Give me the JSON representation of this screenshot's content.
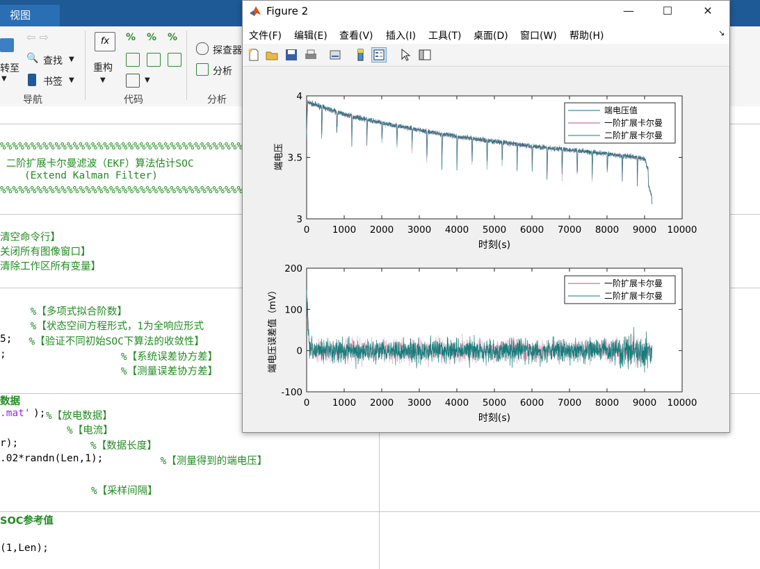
{
  "editor": {
    "tab_label": "视图",
    "ribbon": {
      "goto_label": "转至",
      "find_label": "查找",
      "bookmark_label": "书签",
      "refactor_label": "重构",
      "profiler_label": "探查器",
      "analyze_label": "分析",
      "group_nav": "导航",
      "group_code": "代码",
      "group_analyze": "分析"
    },
    "code_lines": {
      "pct1": "%%%%%%%%%%%%%%%%%%%%%%%%%%%%%%%%%%%%%%%%%%%%%%%",
      "title1": " 二阶扩展卡尔曼滤波（EKF）算法估计SOC",
      "title2": "    (Extend Kalman Filter)",
      "pct2": "%%%%%%%%%%%%%%%%%%%%%%%%%%%%%%%%%%%%%%%%%%%%%%%",
      "c1": "清空命令行】",
      "c2": "关闭所有图像窗口】",
      "c3": "清除工作区所有变量】",
      "c4": "     %【多项式拟合阶数】",
      "c5": "     %【状态空间方程形式，1为全响应形式",
      "c6_code": "5;",
      "c6": "  %【验证不同初始SOC下算法的收敛性】",
      "c7_code": ";",
      "c7": "                   %【系统误差协方差】",
      "c8": "                   %【测量误差协方差】",
      "c9": "数据",
      "c10_str": ".mat'",
      "c10_code": "); ",
      "c10": "%【放电数据】",
      "c11": "           %【电流】",
      "c12_code": "r);",
      "c12": "           %【数据长度】",
      "c13_code": ".02*randn(Len,1);",
      "c13": "         %【测量得到的端电压】",
      "c14": "               %【采样间隔】",
      "c15": "SOC参考值",
      "c16_code": "(1,Len);"
    }
  },
  "figure": {
    "title": "Figure 2",
    "controls": {
      "minimize": "—",
      "maximize": "☐",
      "close": "✕"
    },
    "menu": [
      "文件(F)",
      "编辑(E)",
      "查看(V)",
      "插入(I)",
      "工具(T)",
      "桌面(D)",
      "窗口(W)",
      "帮助(H)"
    ],
    "menu_dock": "↘",
    "colors": {
      "voltage": "#0e6e8e",
      "ekf1": "#c24e7a",
      "ekf2": "#127d7b"
    }
  },
  "chart_data": [
    {
      "type": "line",
      "xlabel": "时刻(s)",
      "ylabel": "端电压",
      "xlim": [
        0,
        10000
      ],
      "ylim": [
        3,
        4
      ],
      "xticks": [
        "0",
        "1000",
        "2000",
        "3000",
        "4000",
        "5000",
        "6000",
        "7000",
        "8000",
        "9000",
        "10000"
      ],
      "yticks": [
        "3",
        "3.5",
        "4"
      ],
      "legend_position": "top-right",
      "series": [
        {
          "name": "端电压值",
          "x": [
            0,
            1000,
            2000,
            3000,
            4000,
            5000,
            6000,
            7000,
            8000,
            9000,
            9200
          ],
          "y": [
            3.95,
            3.85,
            3.78,
            3.72,
            3.67,
            3.63,
            3.59,
            3.56,
            3.53,
            3.49,
            3.3
          ]
        },
        {
          "name": "一阶扩展卡尔曼",
          "x": [
            0,
            1000,
            2000,
            3000,
            4000,
            5000,
            6000,
            7000,
            8000,
            9000,
            9200
          ],
          "y": [
            3.95,
            3.85,
            3.78,
            3.72,
            3.67,
            3.63,
            3.59,
            3.56,
            3.53,
            3.49,
            3.3
          ]
        },
        {
          "name": "二阶扩展卡尔曼",
          "x": [
            0,
            1000,
            2000,
            3000,
            4000,
            5000,
            6000,
            7000,
            8000,
            9000,
            9200
          ],
          "y": [
            3.95,
            3.85,
            3.78,
            3.72,
            3.67,
            3.63,
            3.59,
            3.56,
            3.53,
            3.49,
            3.3
          ]
        }
      ],
      "pulse_drops_approx_every_s": 400
    },
    {
      "type": "line",
      "xlabel": "时刻(s)",
      "ylabel": "端电压误差值（mV）",
      "xlim": [
        0,
        10000
      ],
      "ylim": [
        -100,
        200
      ],
      "xticks": [
        "0",
        "1000",
        "2000",
        "3000",
        "4000",
        "5000",
        "6000",
        "7000",
        "8000",
        "9000",
        "10000"
      ],
      "yticks": [
        "-100",
        "0",
        "100",
        "200"
      ],
      "legend_position": "top-right",
      "series": [
        {
          "name": "一阶扩展卡尔曼",
          "x": [
            0,
            9200
          ],
          "noise_band_mV": [
            -60,
            60
          ],
          "initial_peak_mV": 170
        },
        {
          "name": "二阶扩展卡尔曼",
          "x": [
            0,
            9200
          ],
          "noise_band_mV": [
            -60,
            60
          ],
          "initial_peak_mV": 170
        }
      ]
    }
  ]
}
